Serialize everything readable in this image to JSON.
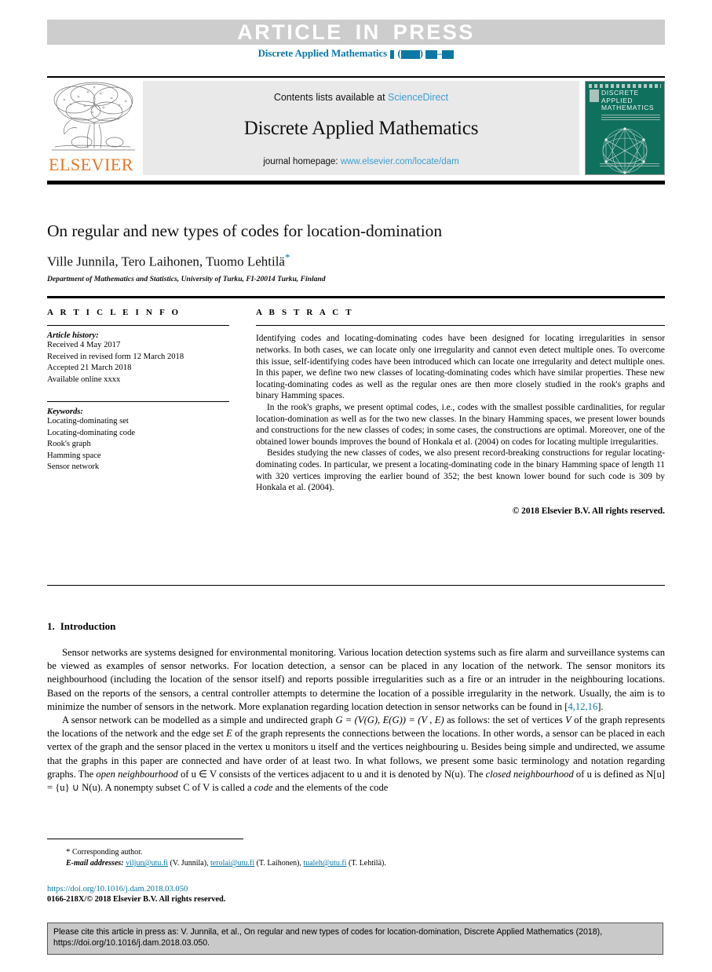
{
  "banner": {
    "article_in_press": "ARTICLE IN PRESS",
    "journal_ref_prefix": "Discrete Applied Mathematics",
    "accent_color": "#0b77a4"
  },
  "masthead": {
    "contents_prefix": "Contents lists available at ",
    "contents_link": "ScienceDirect",
    "journal_title": "Discrete Applied Mathematics",
    "homepage_prefix": "journal homepage: ",
    "homepage_link": "www.elsevier.com/locate/dam",
    "publisher_wordmark": "ELSEVIER",
    "publisher_color": "#e87722",
    "link_color": "#3d9fd0",
    "cover": {
      "line1": "DISCRETE",
      "line2": "APPLIED",
      "line3": "MATHEMATICS",
      "background_color": "#10705e"
    }
  },
  "article": {
    "title": "On regular and new types of codes for location-domination",
    "authors": "Ville Junnila, Tero Laihonen, Tuomo Lehtilä",
    "corresponding_marker": "*",
    "affiliation": "Department of Mathematics and Statistics, University of Turku, FI-20014 Turku, Finland"
  },
  "article_info": {
    "heading": "A R T I C L E  I N F O",
    "history_label": "Article history:",
    "history": [
      "Received 4 May 2017",
      "Received in revised form 12 March 2018",
      "Accepted 21 March 2018",
      "Available online xxxx"
    ],
    "keywords_label": "Keywords:",
    "keywords": [
      "Locating-dominating set",
      "Locating-dominating code",
      "Rook's graph",
      "Hamming space",
      "Sensor network"
    ]
  },
  "abstract": {
    "heading": "A B S T R A C T",
    "paragraphs": [
      "Identifying codes and locating-dominating codes have been designed for locating irregularities in sensor networks. In both cases, we can locate only one irregularity and cannot even detect multiple ones. To overcome this issue, self-identifying codes have been introduced which can locate one irregularity and detect multiple ones. In this paper, we define two new classes of locating-dominating codes which have similar properties. These new locating-dominating codes as well as the regular ones are then more closely studied in the rook's graphs and binary Hamming spaces.",
      "In the rook's graphs, we present optimal codes, i.e., codes with the smallest possible cardinalities, for regular location-domination as well as for the two new classes. In the binary Hamming spaces, we present lower bounds and constructions for the new classes of codes; in some cases, the constructions are optimal. Moreover, one of the obtained lower bounds improves the bound of Honkala et al. (2004) on codes for locating multiple irregularities.",
      "Besides studying the new classes of codes, we also present record-breaking constructions for regular locating-dominating codes. In particular, we present a locating-dominating code in the binary Hamming space of length 11 with 320 vertices improving the earlier bound of 352; the best known lower bound for such code is 309 by Honkala et al. (2004)."
    ],
    "copyright": "© 2018 Elsevier B.V. All rights reserved."
  },
  "introduction": {
    "number": "1.",
    "title": "Introduction",
    "paragraph1_a": "Sensor networks are systems designed for environmental monitoring. Various location detection systems such as fire alarm and surveillance systems can be viewed as examples of sensor networks. For location detection, a sensor can be placed in any location of the network. The sensor monitors its neighbourhood (including the location of the sensor itself) and reports possible irregularities such as a fire or an intruder in the neighbouring locations. Based on the reports of the sensors, a central controller attempts to determine the location of a possible irregularity in the network. Usually, the aim is to minimize the number of sensors in the network. More explanation regarding location detection in sensor networks can be found in [",
    "paragraph1_refs": "4,12,16",
    "paragraph1_b": "].",
    "paragraph2_pre": "A sensor network can be modelled as a simple and undirected graph ",
    "paragraph2_eq1": "G = (V(G), E(G)) = (V , E)",
    "paragraph2_mid1": " as follows: the set of vertices ",
    "paragraph2_v": "V",
    "paragraph2_mid2": " of the graph represents the locations of the network and the edge set ",
    "paragraph2_e": "E",
    "paragraph2_mid3": " of the graph represents the connections between the locations. In other words, a sensor can be placed in each vertex of the graph and the sensor placed in the vertex u monitors u itself and the vertices neighbouring u. Besides being simple and undirected, we assume that the graphs in this paper are connected and have order of at least two. In what follows, we present some basic terminology and notation regarding graphs. The ",
    "paragraph2_it1": "open neighbourhood",
    "paragraph2_mid4": " of u ∈ V consists of the vertices adjacent to u and it is denoted by N(u). The ",
    "paragraph2_it2": "closed neighbourhood",
    "paragraph2_mid5": " of u is defined as N[u] = {u} ∪ N(u). A nonempty subset C of V is called a ",
    "paragraph2_it3": "code",
    "paragraph2_end": " and the elements of the code"
  },
  "footnotes": {
    "corresponding_star": "*",
    "corresponding_text": "Corresponding author.",
    "email_label": "E-mail addresses:",
    "emails": [
      {
        "address": "viljun@utu.fi",
        "person": "(V. Junnila)"
      },
      {
        "address": "terolai@utu.fi",
        "person": "(T. Laihonen)"
      },
      {
        "address": "tualeh@utu.fi",
        "person": "(T. Lehtilä)"
      }
    ],
    "doi": "https://doi.org/10.1016/j.dam.2018.03.050",
    "issn": "0166-218X/© 2018 Elsevier B.V. All rights reserved."
  },
  "citation_box": {
    "line1": "Please cite this article in press as: V. Junnila, et al., On regular and new types of codes for location-domination, Discrete Applied Mathematics (2018),",
    "line2": "https://doi.org/10.1016/j.dam.2018.03.050."
  }
}
